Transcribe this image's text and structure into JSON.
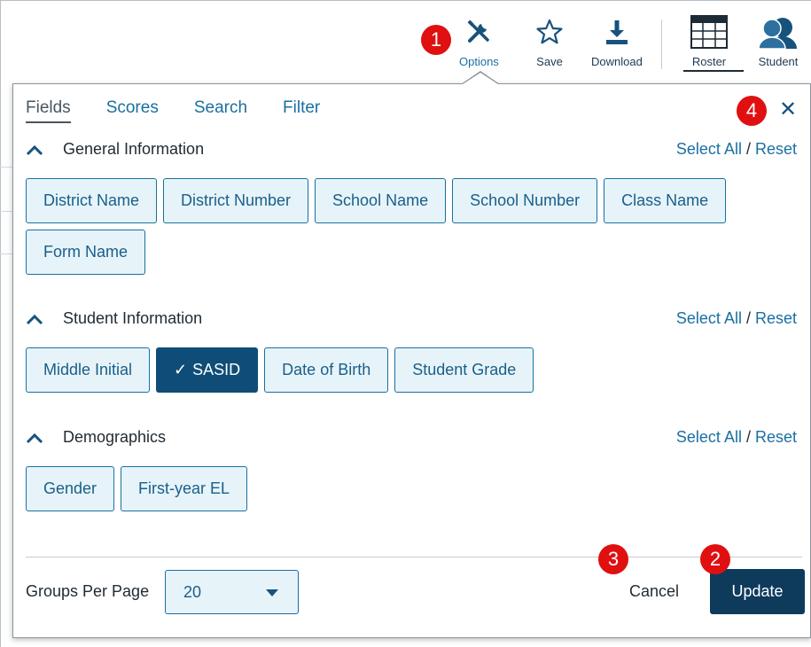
{
  "toolbar": {
    "options_label": "Options",
    "save_label": "Save",
    "download_label": "Download",
    "roster_label": "Roster",
    "student_label": "Student"
  },
  "tabs": [
    {
      "label": "Fields",
      "active": true
    },
    {
      "label": "Scores",
      "active": false
    },
    {
      "label": "Search",
      "active": false
    },
    {
      "label": "Filter",
      "active": false
    }
  ],
  "close_icon": "close-icon",
  "sections": [
    {
      "title": "General Information",
      "select_all": "Select All",
      "reset": "Reset",
      "chips": [
        {
          "label": "District Name",
          "selected": false
        },
        {
          "label": "District Number",
          "selected": false
        },
        {
          "label": "School Name",
          "selected": false
        },
        {
          "label": "School Number",
          "selected": false
        },
        {
          "label": "Class Name",
          "selected": false
        },
        {
          "label": "Form Name",
          "selected": false
        }
      ]
    },
    {
      "title": "Student Information",
      "select_all": "Select All",
      "reset": "Reset",
      "chips": [
        {
          "label": "Middle Initial",
          "selected": false
        },
        {
          "label": "SASID",
          "selected": true
        },
        {
          "label": "Date of Birth",
          "selected": false
        },
        {
          "label": "Student Grade",
          "selected": false
        }
      ]
    },
    {
      "title": "Demographics",
      "select_all": "Select All",
      "reset": "Reset",
      "chips": [
        {
          "label": "Gender",
          "selected": false
        },
        {
          "label": "First-year EL",
          "selected": false
        }
      ]
    }
  ],
  "footer": {
    "groups_per_page_label": "Groups Per Page",
    "groups_per_page_value": "20",
    "cancel_label": "Cancel",
    "update_label": "Update"
  },
  "badges": [
    "1",
    "2",
    "3",
    "4"
  ],
  "colors": {
    "accent": "#1a6fa1",
    "selected_chip": "#0f4d78",
    "update_button": "#0e3a5c",
    "badge": "#e01010"
  }
}
